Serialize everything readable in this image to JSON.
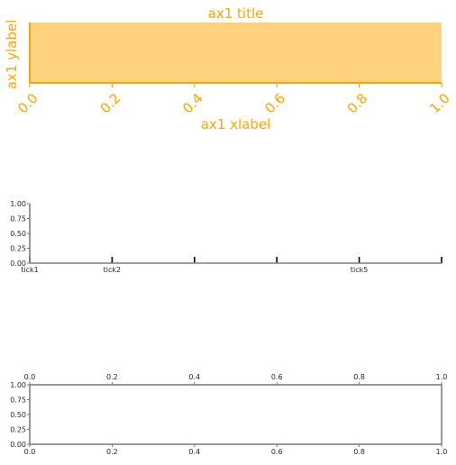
{
  "colors": {
    "accent": "#ffa500",
    "fill": "#ffd27f",
    "axis": "#7f7f7f",
    "tick_dark": "#000000",
    "text": "#262626"
  },
  "chart_data": [
    {
      "type": "area",
      "id": "ax1",
      "title": "ax1 title",
      "xlabel": "ax1 xlabel",
      "ylabel": "ax1 ylabel",
      "xlim": [
        0,
        1
      ],
      "ylim": [
        0,
        1
      ],
      "xticks": [
        0.0,
        0.2,
        0.4,
        0.6,
        0.8,
        1.0
      ],
      "xtick_labels": [
        "0.0",
        "0.2",
        "0.4",
        "0.6",
        "0.8",
        "1.0"
      ],
      "xtick_rotation": "45deg",
      "yticks": [
        0.0,
        0.25,
        0.5,
        0.75,
        1.0
      ],
      "ytick_labels": [
        "",
        "",
        "",
        "",
        ""
      ],
      "facecolor": "#ffd27f",
      "spines": [
        "left",
        "bottom"
      ],
      "grid": false
    },
    {
      "type": "line",
      "id": "ax2",
      "title": "",
      "xlabel": "",
      "ylabel": "",
      "xlim": [
        0,
        1
      ],
      "ylim": [
        0,
        1
      ],
      "xticks": [
        0.0,
        0.2,
        0.4,
        0.6,
        0.8,
        1.0
      ],
      "xtick_labels": [
        "tick1",
        "tick2",
        "",
        "",
        "tick5",
        ""
      ],
      "yticks": [
        0.0,
        0.25,
        0.5,
        0.75,
        1.0
      ],
      "ytick_labels": [
        "0.00",
        "0.25",
        "0.50",
        "0.75",
        "1.00"
      ],
      "spines": [
        "left",
        "bottom"
      ],
      "grid": false
    },
    {
      "type": "line",
      "id": "ax3",
      "title": "",
      "xlabel": "",
      "ylabel": "",
      "xlim": [
        0,
        1
      ],
      "ylim": [
        0,
        1
      ],
      "xticks": [
        0.0,
        0.2,
        0.4,
        0.6,
        0.8,
        1.0
      ],
      "xtick_labels": [
        "0.0",
        "0.2",
        "0.4",
        "0.6",
        "0.8",
        "1.0"
      ],
      "xtick_labels_top": [
        "0.0",
        "0.2",
        "0.4",
        "0.6",
        "0.8",
        "1.0"
      ],
      "yticks": [
        0.0,
        0.25,
        0.5,
        0.75,
        1.0
      ],
      "ytick_labels": [
        "0.00",
        "0.25",
        "0.50",
        "0.75",
        "1.00"
      ],
      "spines": [
        "left",
        "bottom",
        "top",
        "right"
      ],
      "grid": false
    }
  ]
}
